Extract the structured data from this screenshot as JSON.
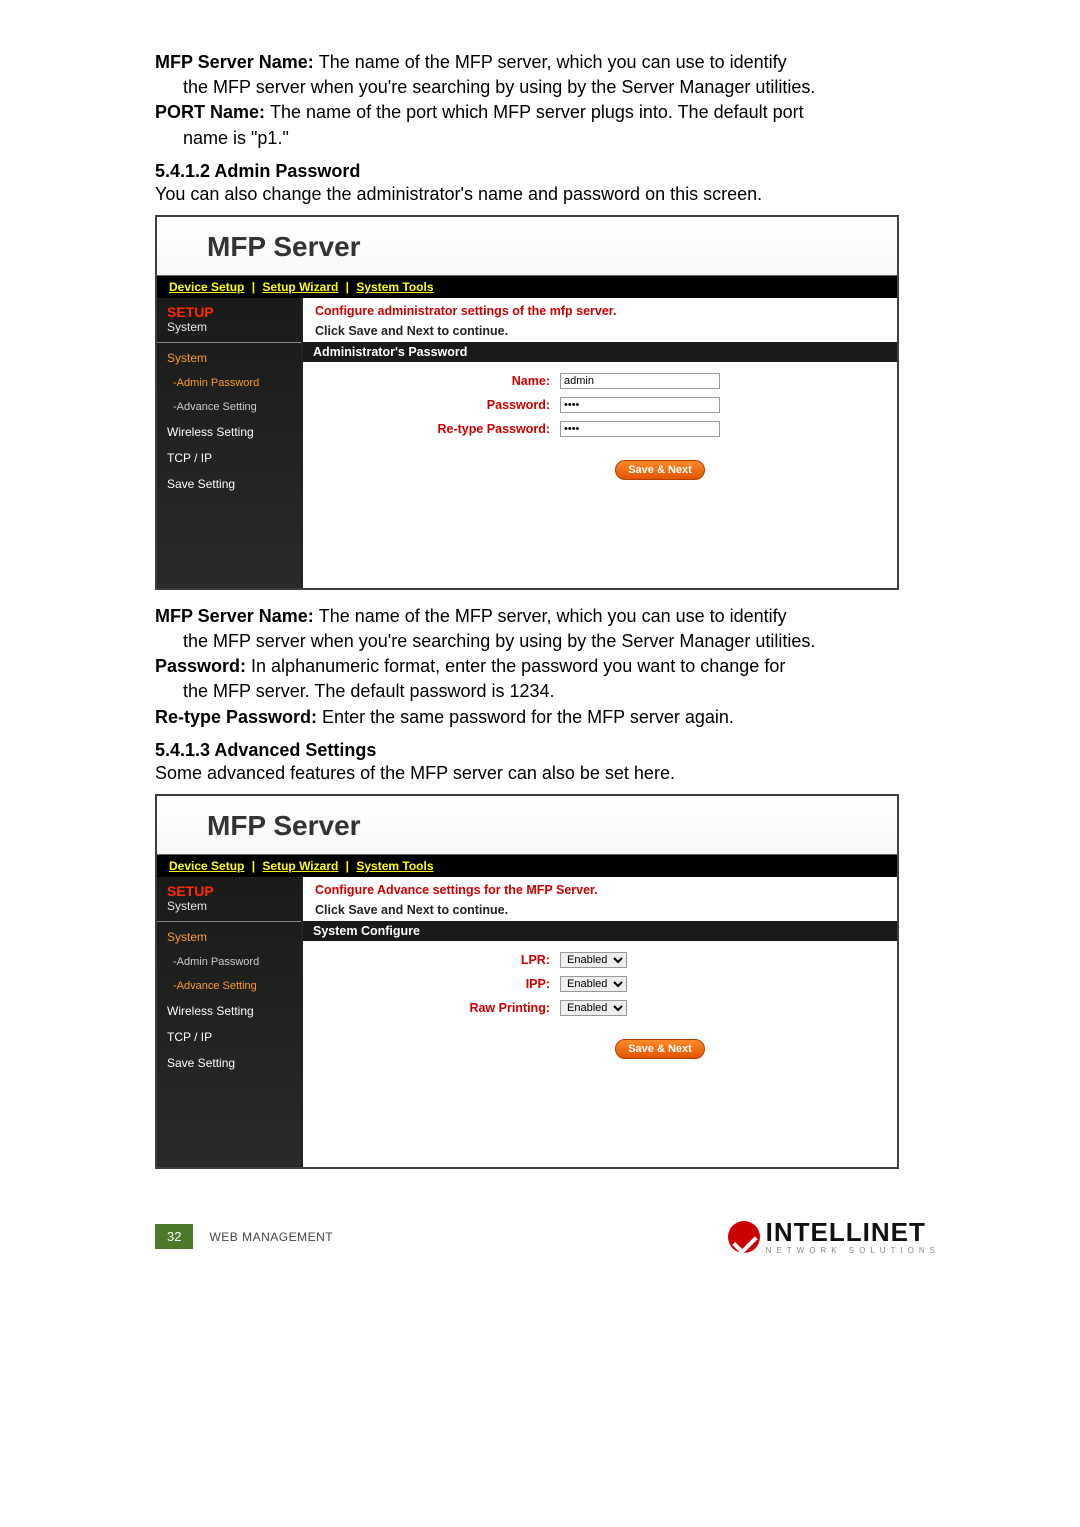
{
  "para1": {
    "l1a": "MFP Server Name: ",
    "l1b": "The name of the MFP server, which you can use to identify",
    "l2": "the MFP server when you're searching by using by the Server Manager utilities.",
    "l3a": "PORT Name: ",
    "l3b": "The name of the port which MFP server plugs into. The default port",
    "l4": "name is \"p1.\""
  },
  "sec1_heading": "5.4.1.2  Admin Password",
  "sec1_intro": "You can also change the administrator's name and password on this screen.",
  "ss": {
    "title": "MFP Server",
    "nav": {
      "device_setup": "Device Setup",
      "setup_wizard": "Setup Wizard",
      "system_tools": "System Tools"
    },
    "sidebar": {
      "hdr": "SETUP",
      "sub": "System",
      "items": [
        {
          "label": "System",
          "cls": "nav-item active"
        },
        {
          "label": "-Admin Password",
          "cls": "nav-item sub active"
        },
        {
          "label": "-Advance Setting",
          "cls": "nav-item sub"
        },
        {
          "label": "Wireless Setting",
          "cls": "nav-item"
        },
        {
          "label": "TCP / IP",
          "cls": "nav-item"
        },
        {
          "label": "Save Setting",
          "cls": "nav-item"
        }
      ]
    },
    "content1": {
      "instr1": "Configure administrator settings of the mfp server.",
      "instr2": "Click Save and Next to continue.",
      "band": "Administrator's Password",
      "rows": [
        {
          "lbl": "Name:",
          "val": "admin",
          "type": "text"
        },
        {
          "lbl": "Password:",
          "val": "••••",
          "type": "password"
        },
        {
          "lbl": "Re-type Password:",
          "val": "••••",
          "type": "password"
        }
      ],
      "btn": "Save & Next"
    }
  },
  "para2": {
    "l1a": "MFP Server Name: ",
    "l1b": "The name of the MFP server, which you can use to identify",
    "l2": "the MFP server when you're searching by using by the Server Manager utilities.",
    "l3a": "Password: ",
    "l3b": "In alphanumeric format, enter the password you want to change for",
    "l4": "the MFP server. The default password is 1234.",
    "l5a": "Re-type Password: ",
    "l5b": "Enter the same password for the MFP server again."
  },
  "sec2_heading": "5.4.1.3  Advanced Settings",
  "sec2_intro": "Some advanced features of the MFP server can also be set here.",
  "ss2": {
    "sidebar_items": [
      {
        "label": "System",
        "cls": "nav-item active"
      },
      {
        "label": "-Admin Password",
        "cls": "nav-item sub"
      },
      {
        "label": "-Advance Setting",
        "cls": "nav-item sub active"
      },
      {
        "label": "Wireless Setting",
        "cls": "nav-item"
      },
      {
        "label": "TCP / IP",
        "cls": "nav-item"
      },
      {
        "label": "Save Setting",
        "cls": "nav-item"
      }
    ],
    "content": {
      "instr1": "Configure Advance settings for the MFP Server.",
      "instr2": "Click Save and Next to continue.",
      "band": "System Configure",
      "rows": [
        {
          "lbl": "LPR:",
          "val": "Enabled"
        },
        {
          "lbl": "IPP:",
          "val": "Enabled"
        },
        {
          "lbl": "Raw Printing:",
          "val": "Enabled"
        }
      ],
      "btn": "Save & Next"
    }
  },
  "footer": {
    "page": "32",
    "section": "WEB MANAGEMENT",
    "brand": "INTELLINET",
    "brand_sub": "NETWORK SOLUTIONS"
  }
}
